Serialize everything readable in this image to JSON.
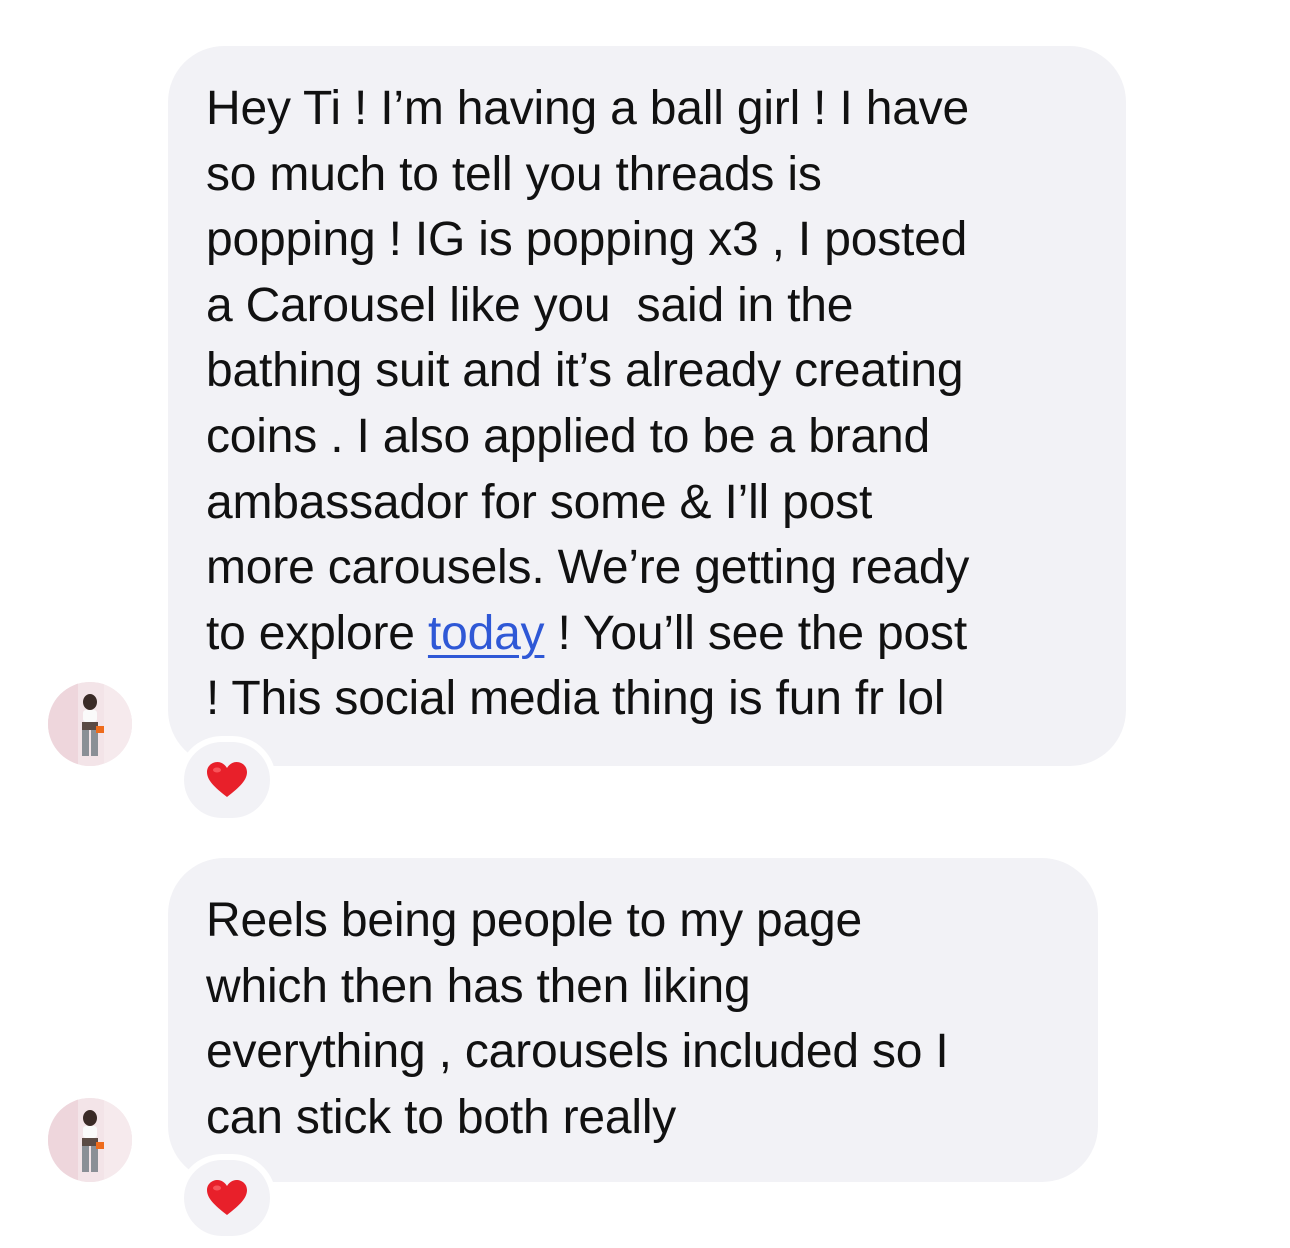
{
  "messages": [
    {
      "lines": [
        "Hey Ti ! I’m having a ball girl ! I have",
        "so much to tell you threads is",
        "popping ! IG is popping x3 , I posted",
        "a Carousel like you  said in the",
        "bathing suit and it’s already creating",
        "coins . I also applied to be a brand",
        "ambassador for some & I’ll post",
        "more carousels. We’re getting ready"
      ],
      "line9_before": "to explore ",
      "line9_link": "today",
      "line9_after": " ! You’ll see the post",
      "line10": "! This social media thing is fun fr lol",
      "reaction": "heart-emoji"
    },
    {
      "lines": [
        "Reels being people to my page",
        "which then has then liking",
        "everything , carousels included so I",
        "can stick to both really"
      ],
      "reaction": "heart-emoji"
    }
  ],
  "colors": {
    "bubble": "#f2f2f6",
    "text": "#111111",
    "link": "#2f58d6",
    "heart": "#e8202a"
  }
}
